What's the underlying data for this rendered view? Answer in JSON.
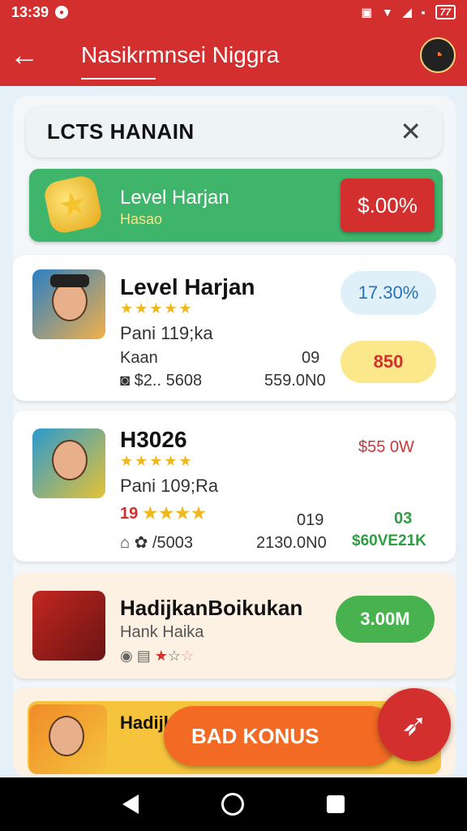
{
  "status": {
    "time": "13:39",
    "battery": "77"
  },
  "app": {
    "title": "Nasikrmnsei Niggra"
  },
  "search": {
    "title": "LCTS HANAIN"
  },
  "banner": {
    "title": "Level Harjan",
    "subtitle": "Hasao",
    "percent": "$.00%"
  },
  "cards": [
    {
      "title": "Level Harjan",
      "line1": "Pani 119;ka",
      "row_a": "Kaan",
      "row_b": "$2.. 5608",
      "val_a": "09",
      "val_b": "559.0N0",
      "pill_top": "17.30%",
      "pill_bottom": "850"
    },
    {
      "title": "H3026",
      "line1": "Pani 109;Ra",
      "rating": "19",
      "row_b": "/5003",
      "val_a": "019",
      "val_b": "2130.0N0",
      "side_amount": "$55 0W",
      "green1": "03",
      "green2": "$60VE21K"
    },
    {
      "title": "HadijkanBoikukan",
      "subtitle": "Hank Haika",
      "pill": "3.00M"
    },
    {
      "title": "Hadijk..."
    }
  ],
  "cta": {
    "label": "BAD KONUS"
  }
}
